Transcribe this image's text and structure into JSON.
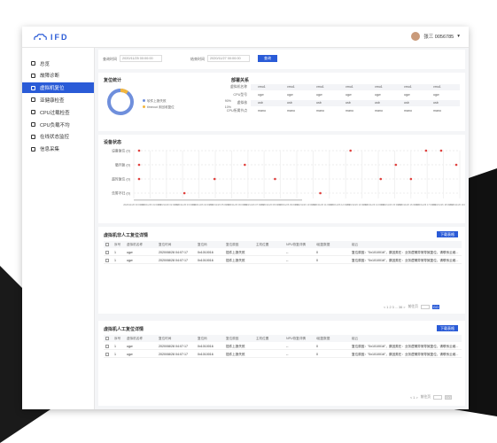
{
  "colors": {
    "accent": "#2a5bd7",
    "red": "#e0403d",
    "donut_main": "#6f8fdc",
    "donut_alt": "#f3b63c"
  },
  "app": {
    "logo_text": "IFD"
  },
  "user": {
    "name": "张三  0056785",
    "dropdown": "▾"
  },
  "sidebar": {
    "items": [
      {
        "label": "总览",
        "icon": "overview-icon"
      },
      {
        "label": "故障诊断",
        "icon": "diagnosis-icon"
      },
      {
        "label": "虚拟机复位",
        "icon": "vm-reset-icon"
      },
      {
        "label": "亚健康检查",
        "icon": "health-check-icon"
      },
      {
        "label": "CPU过载检查",
        "icon": "cpu-overload-icon"
      },
      {
        "label": "CPU负载不均",
        "icon": "cpu-balance-icon"
      },
      {
        "label": "在线状态监控",
        "icon": "online-monitor-icon"
      },
      {
        "label": "信息采集",
        "icon": "info-collect-icon"
      }
    ]
  },
  "filter": {
    "start_label": "查询时间",
    "start_value": "2020/11/25 00:00:00",
    "end_label": "结束时间",
    "end_value": "2020/11/27 00:00:00",
    "search_label": "查询"
  },
  "reset_stats": {
    "title": "复位统计",
    "legend": [
      {
        "label": "软件上报失败",
        "value": "90%"
      },
      {
        "label": "timeout 未回收复位",
        "value": "10%"
      }
    ]
  },
  "deploy": {
    "title": "部署关系",
    "row_labels": [
      "虚拟机名称",
      "CPU型号",
      "虚拟核",
      "CPU所属节点"
    ],
    "rows": [
      [
        "vmu1",
        "vmu1",
        "vmu1",
        "vmu1",
        "vmu1",
        "vmu1",
        "vmu1"
      ],
      [
        "ugw",
        "ugw",
        "ugw",
        "ugw",
        "ugw",
        "ugw",
        "ugw"
      ],
      [
        "usb",
        "usb",
        "usb",
        "usb",
        "usb",
        "usb",
        "usb"
      ],
      [
        "mano",
        "mano",
        "mano",
        "mano",
        "mano",
        "mano",
        "mano"
      ]
    ]
  },
  "device_status": {
    "title": "设备状态",
    "y_labels": [
      "设备复位 (0)",
      "循环复 (0)",
      "超时复位 (0)",
      "告警不归 (0)"
    ],
    "x_labels": [
      "2020/11/26 00:00:00",
      "2020/11/26 01:00:00",
      "2020/11/26 02:00:00",
      "2020/11/26 03:00:00",
      "2020/11/26 04:00:00",
      "2020/11/26 05:00:00",
      "2020/11/26 06:00:00",
      "2020/11/26 07:00:00",
      "2020/11/26 08:00:00",
      "2020/11/26 09:00:00",
      "2020/11/26 10:00:00",
      "2020/11/26 11:00:00",
      "2020/11/26 12:00:00",
      "2020/11/26 13:00:00",
      "2020/11/26 14:00:00",
      "2020/11/26 15:00:00",
      "2020/11/26 16:00:00",
      "2020/11/26 17:00:00",
      "2020/11/26 18:00:00",
      "2020/11/26 19:00:00"
    ]
  },
  "chart_data": {
    "type": "scatter",
    "title": "设备状态",
    "categories_y": [
      "设备复位",
      "循环复",
      "超时复位",
      "告警不归"
    ],
    "points": [
      {
        "x": 0,
        "y": 0
      },
      {
        "x": 0,
        "y": 1
      },
      {
        "x": 0,
        "y": 2
      },
      {
        "x": 3,
        "y": 3
      },
      {
        "x": 5,
        "y": 2
      },
      {
        "x": 7,
        "y": 1
      },
      {
        "x": 9,
        "y": 2
      },
      {
        "x": 12,
        "y": 3
      },
      {
        "x": 14,
        "y": 0
      },
      {
        "x": 17,
        "y": 1
      },
      {
        "x": 16,
        "y": 2
      },
      {
        "x": 19,
        "y": 0
      },
      {
        "x": 18,
        "y": 2
      },
      {
        "x": 20,
        "y": 0
      },
      {
        "x": 21,
        "y": 1
      }
    ]
  },
  "manual_table": {
    "title": "虚拟机非人工复位详情",
    "export_label": "下载表格",
    "headers": [
      "序号",
      "虚拟机名称",
      "复位时间",
      "复位码",
      "复位原因",
      "主机位置",
      "NPU恢复详情",
      "I组复数据",
      "组云"
    ],
    "rows": [
      [
        "1",
        "ugw",
        "2020/08/28 04:07:17",
        "0x1010016",
        "插件上报失败",
        "",
        "--",
        "0",
        "复位原因：\"0x1010016\"，原因类在：业务逻辑异常导致复位，请联系云维..."
      ],
      [
        "1",
        "ugw",
        "2020/08/28 04:07:17",
        "0x1010016",
        "插件上报失败",
        "",
        "--",
        "0",
        "复位原因：\"0x1010016\"，原因类在：业务逻辑异常导致复位，请联系云维..."
      ]
    ],
    "pager": {
      "text": "< 1  2  3 ... 36 >",
      "jump_label": "前往页",
      "go_label": "GO"
    }
  },
  "auto_table": {
    "title": "虚拟机人工复位详情",
    "export_label": "下载表格",
    "headers": [
      "序号",
      "虚拟机名称",
      "复位时间",
      "复位码",
      "复位原因",
      "主机位置",
      "NPU恢复详情",
      "I组复数据",
      "组云"
    ],
    "rows": [
      [
        "1",
        "ugw",
        "2020/08/28 04:07:17",
        "0x1010016",
        "插件上报失败",
        "",
        "--",
        "0",
        "复位原因：\"0x1010016\"，原因类在：业务逻辑异常导致复位，请联系云维..."
      ],
      [
        "1",
        "ugw",
        "2020/08/28 04:07:17",
        "0x1010016",
        "插件上报失败",
        "",
        "--",
        "0",
        "复位原因：\"0x1010016\"，原因类在：业务逻辑异常导致复位，请联系云维..."
      ]
    ],
    "pager": {
      "text": "< 1 >",
      "jump_label": "前往页",
      "go_label": "GO"
    }
  }
}
